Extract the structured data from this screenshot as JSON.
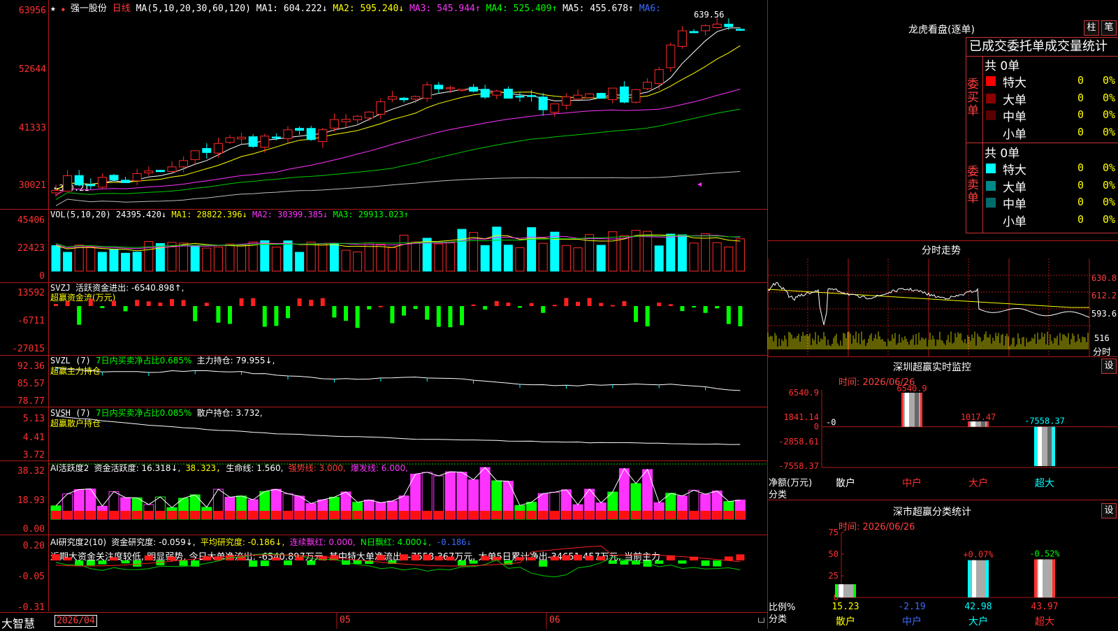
{
  "header": {
    "star": "★",
    "diamond": "◆",
    "stock_name": "强一股份",
    "period": "日线",
    "ma_label": "MA(5,10,20,30,60,120)",
    "ma1": "MA1: 604.222↓",
    "ma2": "MA2: 595.240↓",
    "ma3": "MA3: 545.944↑",
    "ma4": "MA4: 525.409↑",
    "ma5": "MA5: 455.678↑",
    "ma6": "MA6:"
  },
  "main_panel": {
    "y_ticks": [
      "63956",
      "52644",
      "41333",
      "30021"
    ],
    "high_label": "639.56",
    "low_label": "←300.21",
    "colors": {
      "up": "#ff2a2a",
      "down": "#00ffff",
      "ma1": "#ffffff",
      "ma2": "#ffff00",
      "ma3": "#ff33ff",
      "ma4": "#00cc00",
      "ma5": "#bbbbbb"
    }
  },
  "vol_panel": {
    "label": "VOL(5,10,20)",
    "value": "24395.420↓",
    "ma1": "MA1: 28822.396↓",
    "ma2": "MA2: 30399.385↓",
    "ma3": "MA3: 29913.023↑",
    "y_ticks": [
      "45406",
      "22423",
      "0"
    ]
  },
  "svzj_panel": {
    "label": "SVZJ",
    "desc": "活跃资金进出: -6540.898↑,",
    "sub": "超赢资金流(万元)",
    "y_ticks": [
      "13592",
      "-6711",
      "-27015"
    ]
  },
  "svzl_panel": {
    "label": "SVZL (7)",
    "desc": "7日内买卖净占比0.685%",
    "main": "主力持仓: 79.955↓,",
    "sub": "超赢主力持仓",
    "y_ticks": [
      "92.36",
      "85.57",
      "78.77"
    ]
  },
  "svsh_panel": {
    "label": "SVSH (7)",
    "desc": "7日内买卖净占比0.085%",
    "main": "散户持仓: 3.732,",
    "sub": "超赢散户持仓",
    "y_ticks": [
      "5.13",
      "4.41",
      "3.72"
    ]
  },
  "ai1_panel": {
    "label": "AI活跃度2",
    "v1": "资金活跃度: 16.318↓,",
    "v2": "38.323,",
    "v3": "生命线: 1.560,",
    "v4": "强势线: 3.000,",
    "v5": "爆发线: 6.000,",
    "y_ticks": [
      "38.32",
      "18.93",
      "0.00"
    ]
  },
  "ai2_panel": {
    "label": "AI研究度2(10)",
    "v1": "资金研究度: -0.059↓,",
    "v2": "平均研究度: -0.186↓,",
    "v3": "连续飘红: 0.000,",
    "v4": "N日飘红: 4.000↓,",
    "v5": "-0.186↓",
    "commentary": "近期大资金关注度较低, 明显弱势, 今日大单净流出: -6540.897万元, 其中特大单净流出: -7558.367万元, 大单5日累计净出-34651.457万元, 当前主力",
    "y_ticks": [
      "0.20",
      "-0.05",
      "-0.31"
    ]
  },
  "x_axis": {
    "brand": "大智慧",
    "date_start": "2026/04",
    "m05": "05",
    "m06": "06"
  },
  "lhb": {
    "title": "龙虎看盘(逐单)",
    "btn_zhu": "柱",
    "btn_bi": "笔",
    "tabs_text": "已成交委托单成交量统计",
    "buy_label": "委买单",
    "sell_label": "委卖单",
    "buy_total": "共 0单",
    "sell_total": "共 0单",
    "buy_rows": [
      {
        "label": "特大",
        "count": "0",
        "pct": "0%",
        "color": "#ff0000"
      },
      {
        "label": "大单",
        "count": "0",
        "pct": "0%",
        "color": "#8b0000"
      },
      {
        "label": "中单",
        "count": "0",
        "pct": "0%",
        "color": "#5a0000"
      },
      {
        "label": "小单",
        "count": "0",
        "pct": "0%",
        "color": ""
      }
    ],
    "sell_rows": [
      {
        "label": "特大",
        "count": "0",
        "pct": "0%",
        "color": "#00ffff"
      },
      {
        "label": "大单",
        "count": "0",
        "pct": "0%",
        "color": "#008b8b"
      },
      {
        "label": "中单",
        "count": "0",
        "pct": "0%",
        "color": "#006b6b"
      },
      {
        "label": "小单",
        "count": "0",
        "pct": "0%",
        "color": ""
      }
    ]
  },
  "intraday": {
    "title": "分时走势",
    "y_ticks": [
      "630.8",
      "612.2",
      "593.6"
    ],
    "vol_tick": "516",
    "vol_unit": "分时"
  },
  "sz_monitor": {
    "title": "深圳超赢实时监控",
    "btn": "设",
    "time": "时间: 2026/06/26",
    "y_ticks": [
      "6540.9",
      "1841.14",
      "0",
      "-2858.61",
      "-7558.37"
    ],
    "zero_marker": "-0",
    "unit_label": "净额(万元)",
    "category_label": "分类",
    "chart_data": {
      "type": "bar",
      "categories": [
        "散户",
        "中户",
        "大户",
        "超大"
      ],
      "values": [
        0,
        6540.9,
        1017.47,
        -7558.37
      ],
      "value_labels": [
        "",
        "6540.9",
        "1017.47",
        "-7558.37"
      ],
      "ylim": [
        -7558.37,
        6540.9
      ],
      "category_colors": [
        "#ffffff",
        "#ff3030",
        "#ff3030",
        "#00ffff"
      ]
    }
  },
  "sz_classify": {
    "title": "深市超赢分类统计",
    "btn": "设",
    "time": "时间: 2026/06/26",
    "y_ticks": [
      "75",
      "50",
      "25",
      "0"
    ],
    "ratio_label": "比例%",
    "category_label": "分类",
    "chart_data": {
      "type": "bar",
      "categories": [
        "散户",
        "中户",
        "大户",
        "超大"
      ],
      "values": [
        15.23,
        -2.19,
        42.98,
        43.97
      ],
      "value_labels": [
        "15.23",
        "-2.19",
        "42.98",
        "43.97"
      ],
      "change_labels": [
        "",
        "",
        "+0.07%",
        "-0.52%"
      ],
      "ylim": [
        0,
        75
      ],
      "category_colors": [
        "#ffff00",
        "#3c6cff",
        "#00ffff",
        "#ff3030"
      ]
    }
  }
}
